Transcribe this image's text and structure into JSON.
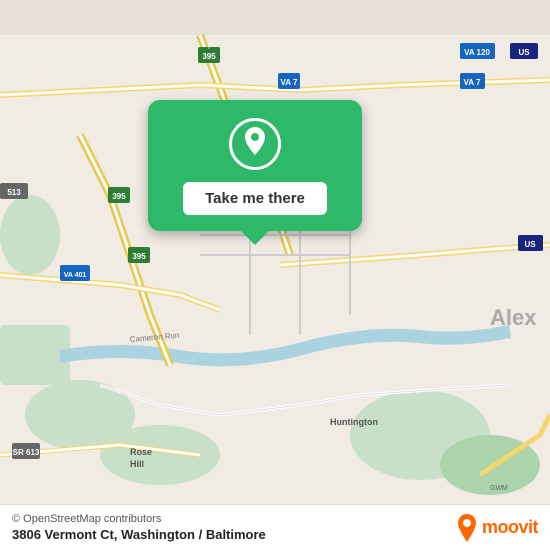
{
  "map": {
    "attribution": "© OpenStreetMap contributors",
    "center_address": "3806 Vermont Ct, Washington / Baltimore"
  },
  "popup": {
    "button_label": "Take me there"
  },
  "moovit": {
    "logo_text": "moovit"
  }
}
